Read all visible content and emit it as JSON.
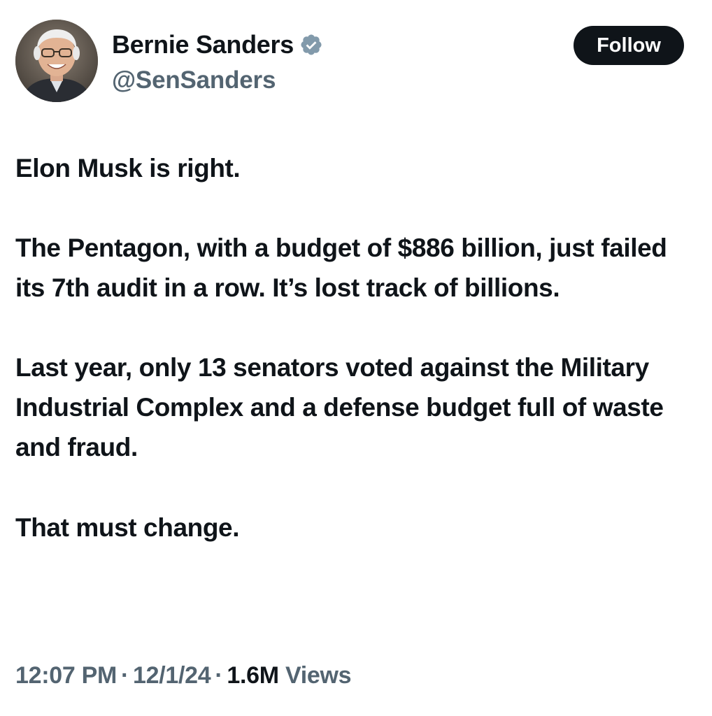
{
  "author": {
    "display_name": "Bernie Sanders",
    "handle": "@SenSanders",
    "verified": true,
    "verified_color": "#829aab"
  },
  "follow_button": {
    "label": "Follow"
  },
  "tweet": {
    "paragraphs": [
      "Elon Musk is right.",
      "The Pentagon, with a budget of $886 billion, just failed its 7th audit in a row. It’s lost track of billions.",
      "Last year, only 13 senators voted against the Military Industrial Complex and a defense budget full of waste and fraud.",
      "That must change."
    ]
  },
  "meta": {
    "time": "12:07 PM",
    "separator": "·",
    "date": "12/1/24",
    "views_count": "1.6M",
    "views_label": "Views"
  },
  "colors": {
    "text_primary": "#0f1419",
    "text_secondary": "#536471",
    "button_bg": "#0f1419",
    "button_text": "#ffffff",
    "background": "#ffffff"
  },
  "icons": {
    "avatar": "profile-photo",
    "verified": "verified-badge-icon"
  }
}
